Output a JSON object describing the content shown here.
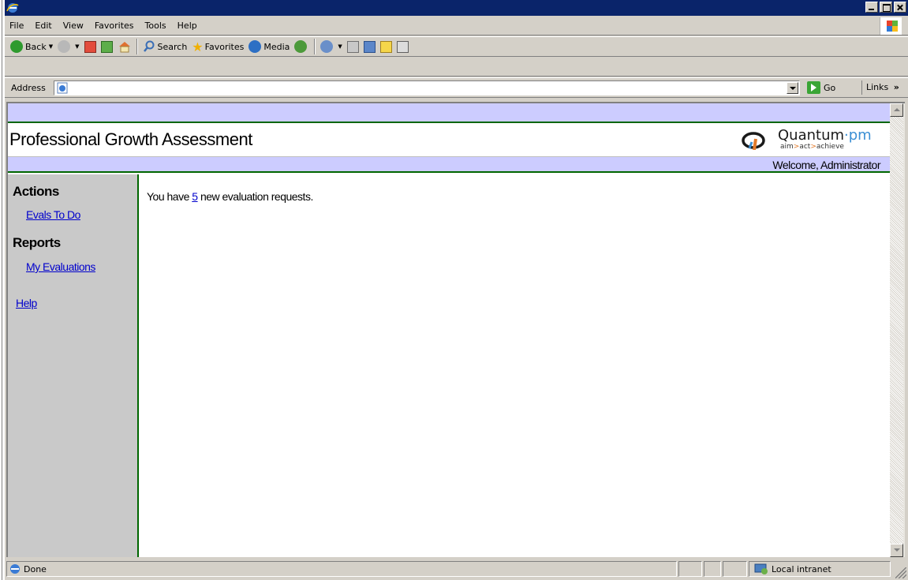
{
  "window": {
    "title": "",
    "icon": "ie-icon"
  },
  "menubar": {
    "items": [
      "File",
      "Edit",
      "View",
      "Favorites",
      "Tools",
      "Help"
    ]
  },
  "toolbar": {
    "back_label": "Back",
    "search_label": "Search",
    "favorites_label": "Favorites",
    "media_label": "Media"
  },
  "address": {
    "label": "Address",
    "value": "",
    "go_label": "Go",
    "links_label": "Links"
  },
  "app": {
    "title": "Professional Growth Assessment",
    "logo": {
      "brand_main": "Quantum",
      "brand_dot": "·",
      "brand_suffix": "pm",
      "tag_aim": "aim",
      "tag_act": "act",
      "tag_achieve": "achieve",
      "tag_sep": ">"
    },
    "welcome": "Welcome, Administrator",
    "colors": {
      "band": "#ccccff",
      "border": "#006600",
      "sidebar": "#c9c9c9",
      "link": "#0000cc"
    }
  },
  "sidebar": {
    "actions_heading": "Actions",
    "evals_to_do": "Evals To Do",
    "reports_heading": "Reports",
    "my_evaluations": "My Evaluations",
    "help": "Help"
  },
  "main": {
    "msg_before": "You have ",
    "msg_count": "5",
    "msg_after": " new evaluation requests."
  },
  "status": {
    "text": "Done",
    "zone": "Local intranet"
  }
}
